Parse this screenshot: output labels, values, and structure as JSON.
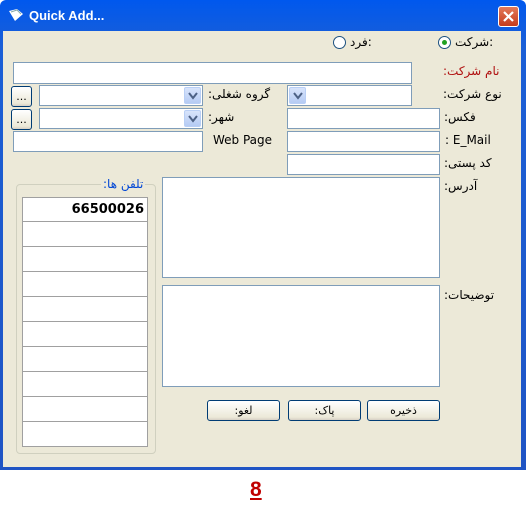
{
  "window": {
    "title": "Quick Add..."
  },
  "entity_type": {
    "company_label": ":شرکت",
    "person_label": ":فرد",
    "selected": "company"
  },
  "labels": {
    "company_name": "نام شرکت:",
    "company_type": "نوع شرکت:",
    "business_group": "گروه شغلی:",
    "city": "شهر:",
    "fax": "فکس:",
    "email": ": E_Mail",
    "web_page": "Web Page",
    "postal_code": "کد پستی:",
    "address": "آدرس:",
    "notes": "توضیحات:",
    "phones": "تلفن ها:"
  },
  "phones": [
    "66500026",
    "",
    "",
    "",
    "",
    "",
    "",
    "",
    "",
    ""
  ],
  "buttons": {
    "browse1": "...",
    "browse2": "...",
    "save": "ذخیره",
    "clear": ":پاک",
    "cancel": ":لغو"
  },
  "page_number": "8",
  "colors": {
    "title_bar": "#1f54c4",
    "client_bg": "#ece9d8",
    "required_label": "#b01010",
    "page_number": "#c00000"
  }
}
